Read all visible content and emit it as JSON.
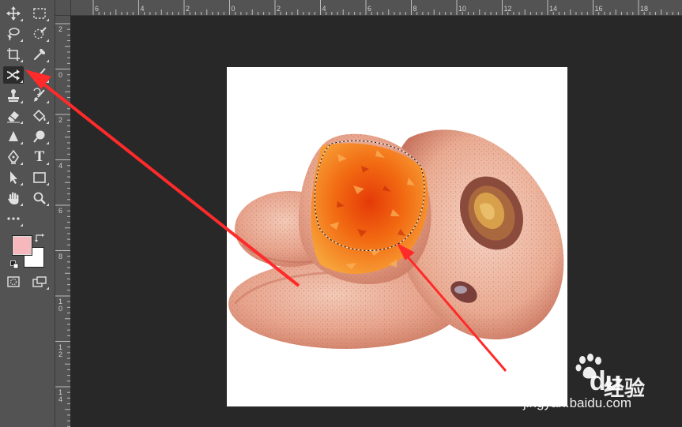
{
  "toolbar": {
    "tools": [
      {
        "name": "move-tool",
        "icon": "move-icon"
      },
      {
        "name": "marquee-tool",
        "icon": "rect-marquee-icon"
      },
      {
        "name": "lasso-tool",
        "icon": "lasso-icon"
      },
      {
        "name": "quick-selection-tool",
        "icon": "quick-select-icon"
      },
      {
        "name": "crop-tool",
        "icon": "crop-icon"
      },
      {
        "name": "eyedropper-tool",
        "icon": "eyedropper-icon"
      },
      {
        "name": "content-aware-move-tool",
        "icon": "content-aware-move-icon",
        "active": true
      },
      {
        "name": "brush-tool",
        "icon": "brush-icon"
      },
      {
        "name": "stamp-tool",
        "icon": "stamp-icon"
      },
      {
        "name": "history-brush-tool",
        "icon": "history-brush-icon"
      },
      {
        "name": "eraser-tool",
        "icon": "eraser-icon"
      },
      {
        "name": "paint-bucket-tool",
        "icon": "paint-bucket-icon"
      },
      {
        "name": "blur-tool",
        "icon": "blur-icon"
      },
      {
        "name": "dodge-tool",
        "icon": "dodge-icon"
      },
      {
        "name": "pen-tool",
        "icon": "pen-icon"
      },
      {
        "name": "type-tool",
        "icon": "type-icon"
      },
      {
        "name": "path-selection-tool",
        "icon": "arrow-icon"
      },
      {
        "name": "rectangle-tool",
        "icon": "rectangle-icon"
      },
      {
        "name": "hand-tool",
        "icon": "hand-icon"
      },
      {
        "name": "zoom-tool",
        "icon": "zoom-icon"
      },
      {
        "name": "more-tools",
        "icon": "ellipsis-icon"
      }
    ],
    "type_tool_label": "T",
    "foreground_color": "#f6b8bc",
    "background_color": "#ffffff"
  },
  "ruler_top_labels": [
    "6",
    "4",
    "2",
    "0",
    "2",
    "4",
    "6",
    "8",
    "10",
    "12",
    "14",
    "16",
    "18"
  ],
  "ruler_left_labels": [
    "2",
    "0",
    "2",
    "4",
    "6",
    "8",
    "10",
    "12",
    "14"
  ],
  "annotation_color": "#ff2a2a",
  "watermark": {
    "brand": "Bai",
    "brand_end": "du",
    "brand_cn": "经验",
    "url": "jingyan.baidu.com"
  }
}
